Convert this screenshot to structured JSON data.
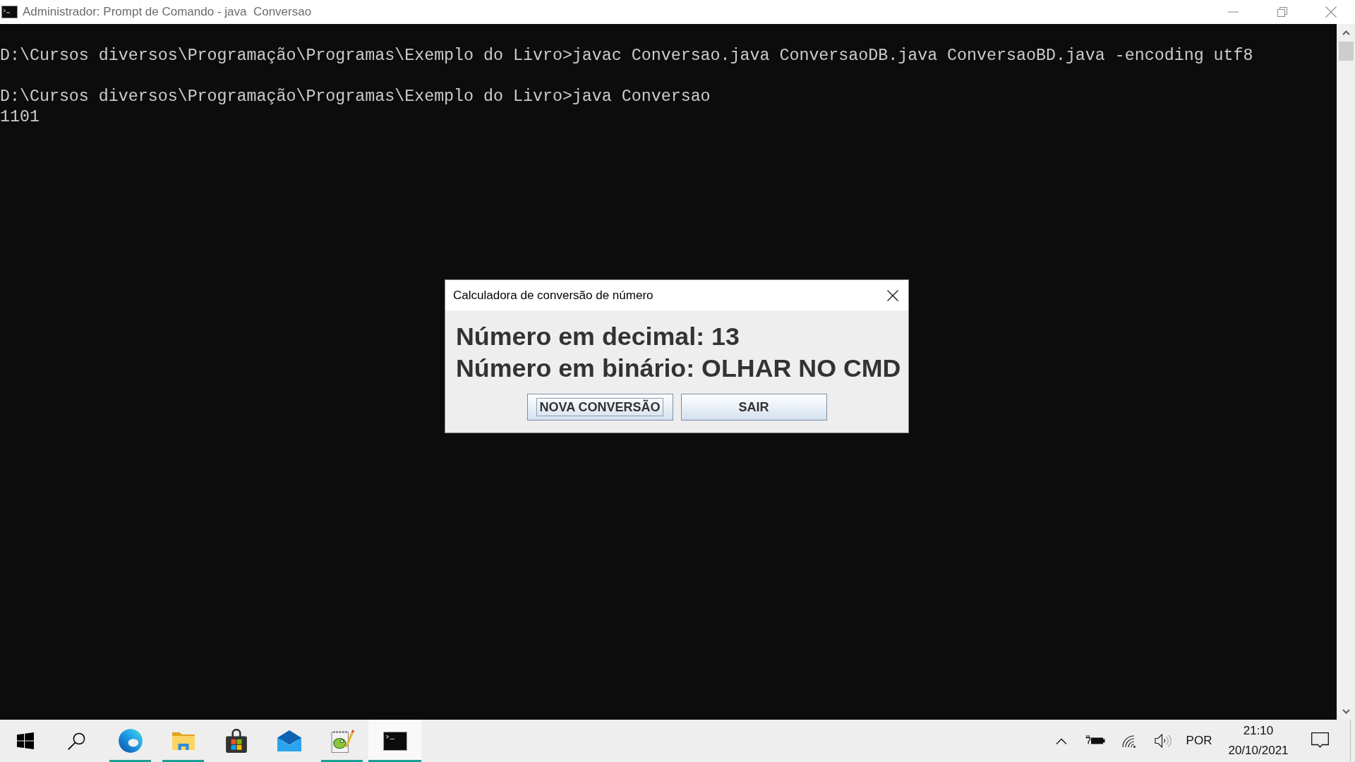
{
  "window": {
    "title": "Administrador: Prompt de Comando - java  Conversao"
  },
  "console": {
    "lines": [
      {
        "kind": "command",
        "text": "D:\\Cursos diversos\\Programação\\Programas\\Exemplo do Livro>javac Conversao.java ConversaoDB.java ConversaoBD.java -encoding utf8"
      },
      {
        "kind": "command",
        "text": "D:\\Cursos diversos\\Programação\\Programas\\Exemplo do Livro>java Conversao"
      },
      {
        "kind": "output",
        "text": "1101"
      }
    ]
  },
  "dialog": {
    "title": "Calculadora de conversão de número",
    "labels": [
      "Número em decimal: 13",
      "Número em binário: OLHAR NO CMD"
    ],
    "buttons": [
      {
        "label": "NOVA CONVERSÃO",
        "focused": true
      },
      {
        "label": "SAIR",
        "focused": false
      }
    ]
  },
  "taskbar": {
    "buttons": [
      {
        "kind": "start",
        "running": false,
        "selected": false
      },
      {
        "kind": "search",
        "running": false,
        "selected": false
      },
      {
        "kind": "browser",
        "running": true,
        "selected": false
      },
      {
        "kind": "files",
        "running": true,
        "selected": false
      },
      {
        "kind": "store",
        "running": false,
        "selected": false
      },
      {
        "kind": "mail",
        "running": false,
        "selected": false
      },
      {
        "kind": "editor",
        "running": true,
        "selected": false
      },
      {
        "kind": "terminal",
        "running": true,
        "selected": true
      }
    ],
    "tray": {
      "language": "POR",
      "time": "21:10",
      "date": "20/10/2021"
    }
  }
}
